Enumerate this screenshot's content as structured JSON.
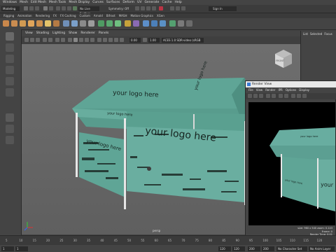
{
  "menu": [
    "Windows",
    "Mesh",
    "Edit Mesh",
    "Mesh Tools",
    "Mesh Display",
    "Curves",
    "Surfaces",
    "Deform",
    "UV",
    "Generate",
    "Cache",
    "Help"
  ],
  "status": {
    "mode": "Modeling",
    "live_surface": "No Live Surface",
    "symmetry": "Symmetry: Off",
    "sign_in": "Sign In"
  },
  "shelf_tabs": [
    "Rigging",
    "Animation",
    "Rendering",
    "FX",
    "FX Caching",
    "Custom",
    "Arnold",
    "Bifrost",
    "MASH",
    "Motion Graphics",
    "XGen"
  ],
  "panel_menu": [
    "View",
    "Shading",
    "Lighting",
    "Show",
    "Renderer",
    "Panels"
  ],
  "panel_fields": {
    "value_a": "0.00",
    "value_b": "1.00",
    "color_space": "ACES 1.0 SDR-video (sRGB"
  },
  "viewcube_label": "FRONT",
  "camera_label": "persp",
  "right_panel": [
    "List",
    "Selected",
    "Focus"
  ],
  "tent": {
    "logo_text": "your logo here",
    "color": "#5fa596"
  },
  "render_view": {
    "title": "Render View",
    "menu": [
      "File",
      "View",
      "Render",
      "IPR",
      "Options",
      "Display"
    ],
    "info_size": "size: 960 x 540 zoom: 0.143",
    "info_frame": "Frame: 0",
    "info_time": "Render Time: 0:01"
  },
  "timeline": {
    "frames": [
      "5",
      "10",
      "15",
      "20",
      "25",
      "30",
      "35",
      "40",
      "45",
      "50",
      "55",
      "60",
      "65",
      "70",
      "75",
      "80",
      "85",
      "90",
      "95",
      "100",
      "105",
      "110",
      "115",
      "120"
    ]
  },
  "bottom": {
    "start": "1",
    "start2": "1",
    "end": "120",
    "end2": "120",
    "field_a": "200",
    "field_b": "200",
    "character_set": "No Character Set",
    "anim_layer": "No Anim Layer"
  }
}
